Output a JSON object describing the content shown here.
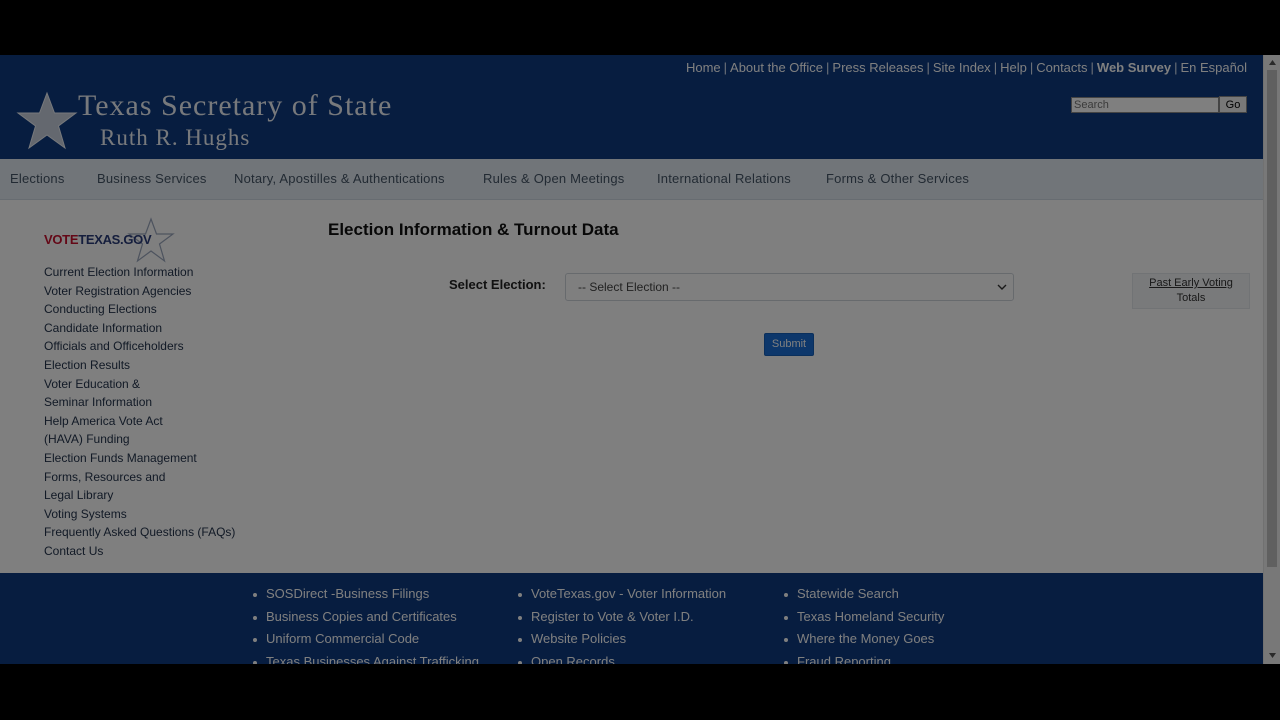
{
  "header": {
    "top_links": [
      {
        "label": "Home",
        "bold": false
      },
      {
        "label": "About the Office",
        "bold": false
      },
      {
        "label": "Press Releases",
        "bold": false
      },
      {
        "label": "Site Index",
        "bold": false
      },
      {
        "label": "Help",
        "bold": false
      },
      {
        "label": "Contacts",
        "bold": false
      },
      {
        "label": "Web Survey",
        "bold": true
      },
      {
        "label": "En Español",
        "bold": false
      }
    ],
    "title": "Texas Secretary of State",
    "subtitle": "Ruth R. Hughs",
    "search": {
      "placeholder": "Search",
      "button": "Go"
    }
  },
  "nav": {
    "items": [
      "Elections",
      "Business Services",
      "Notary, Apostilles & Authentications",
      "Rules & Open Meetings",
      "International Relations",
      "Forms & Other Services"
    ]
  },
  "sidebar": {
    "logo_red": "VOTE",
    "logo_blue": "TEXAS.GOV",
    "items": [
      "Current Election Information",
      "Voter Registration Agencies",
      "Conducting Elections",
      "Candidate Information",
      "Officials and Officeholders",
      "Election Results",
      "Voter Education &",
      "Seminar Information",
      "Help America Vote Act",
      "(HAVA) Funding",
      "Election Funds Management",
      "Forms, Resources and",
      "Legal Library",
      "Voting Systems",
      "Frequently Asked Questions (FAQs)",
      "Contact Us"
    ]
  },
  "main": {
    "title": "Election Information & Turnout Data",
    "select_label": "Select Election:",
    "select_value": "-- Select Election --",
    "submit_label": "Submit",
    "past_line1": "Past Early Voting",
    "past_line2": "Totals"
  },
  "footer": {
    "col1": [
      "SOSDirect -Business Filings",
      "Business Copies and Certificates",
      "Uniform Commercial Code",
      "Texas Businesses Against Trafficking"
    ],
    "col2": [
      "VoteTexas.gov - Voter Information",
      "Register to Vote & Voter I.D.",
      "Website Policies",
      "Open Records"
    ],
    "col3": [
      "Statewide Search",
      "Texas Homeland Security",
      "Where the Money Goes",
      "Fraud Reporting"
    ]
  },
  "colors": {
    "header_bg": "#0e3a80",
    "nav_bg": "#e3eaf2",
    "submit_bg": "#1a6fd6",
    "vote_red": "#c8102e",
    "overlay": "rgba(0,0,0,0.5)"
  }
}
